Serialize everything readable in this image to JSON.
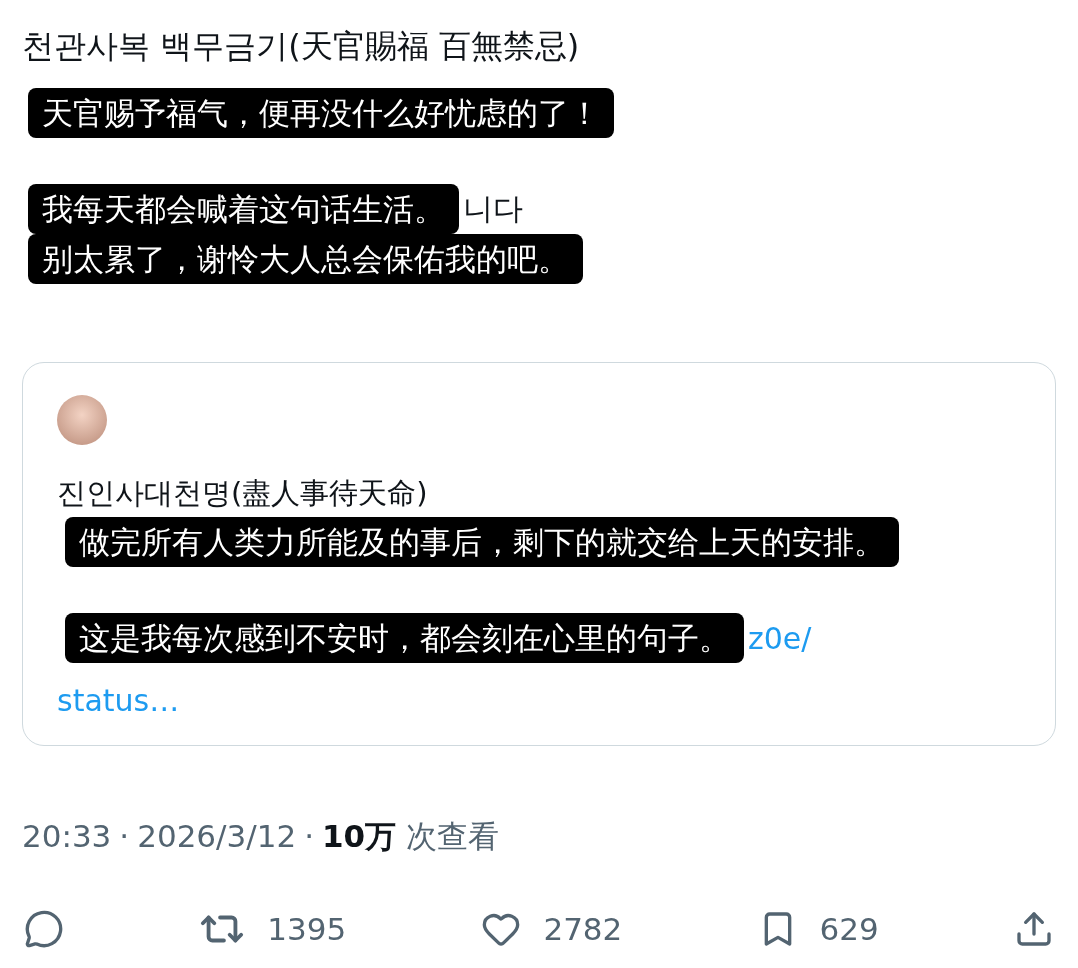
{
  "post": {
    "title": "천관사복 백무금기(天官賜福 百無禁忌)",
    "paragraphs": [
      [
        {
          "text": "天官赐予福气，便再没什么好忧虑的了！"
        }
      ],
      [
        {
          "text": "我每天都会喊着这句话生活。",
          "trailing": "니다"
        },
        {
          "text": "别太累了，谢怜大人总会保佑我的吧。"
        }
      ]
    ]
  },
  "quote": {
    "title": "진인사대천명(盡人事待天命)",
    "paragraphs": [
      [
        {
          "text": "做完所有人类力所能及的事后，剩下的就交给上天的安排。"
        }
      ],
      [
        {
          "text": "这是我每次感到不安时，都会刻在心里的句子。",
          "trailing": "z0e/"
        }
      ]
    ],
    "link_more": "status…"
  },
  "meta": {
    "time": "20:33",
    "separator": "·",
    "date": "2026/3/12",
    "separator_2": "·",
    "views": "10万",
    "views_label": "次查看"
  },
  "actions": [
    {
      "kind": "reply"
    },
    {
      "kind": "retweet",
      "count": "1395"
    },
    {
      "kind": "like",
      "count": "2782"
    },
    {
      "kind": "bookmark",
      "count": "629"
    },
    {
      "kind": "share"
    }
  ]
}
